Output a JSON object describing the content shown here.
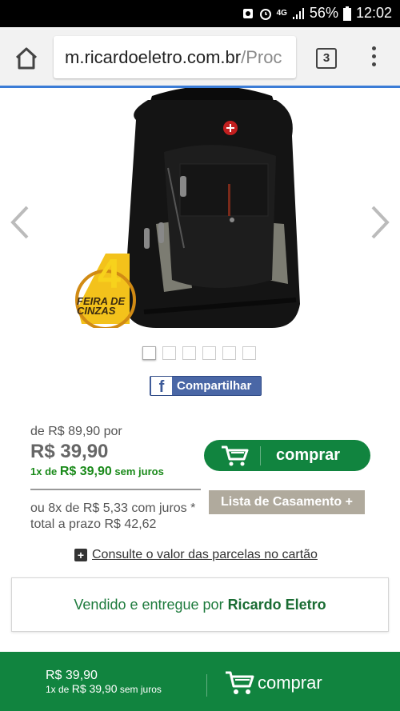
{
  "status_bar": {
    "battery": "56%",
    "time": "12:02",
    "network": "4G"
  },
  "browser": {
    "url_domain": "m.ricardoeletro.com.br",
    "url_path": "/Proc",
    "tab_count": "3"
  },
  "product": {
    "image_name": "black-backpack",
    "badge_number": "4",
    "badge_text": "FEIRA DE CINZAS",
    "carousel_dots": 6,
    "share_label": "Compartilhar"
  },
  "pricing": {
    "old_price": "de R$ 89,90 por",
    "price": "R$ 39,90",
    "one_x_prefix": "1x de ",
    "one_x_value": "R$ 39,90",
    "one_x_suffix": " sem juros",
    "installments_line1": "ou 8x de R$ 5,33 com juros *",
    "installments_line2": "total a prazo R$ 42,62"
  },
  "actions": {
    "buy_label": "comprar",
    "wedding_list_label": "Lista de Casamento +"
  },
  "consult": {
    "label": "Consulte o valor das parcelas no cartão"
  },
  "seller": {
    "prefix": "Vendido e entregue por ",
    "name": "Ricardo Eletro"
  },
  "bottom_bar": {
    "price": "R$ 39,90",
    "one_x_prefix": "1x de ",
    "one_x_value": "R$ 39,90",
    "one_x_suffix": " sem juros",
    "buy_label": "comprar"
  },
  "colors": {
    "brand_green": "#11843f",
    "facebook_blue": "#4a67a6",
    "wedding_button": "#b0aa9d",
    "progress_blue": "#3b7cd6"
  }
}
